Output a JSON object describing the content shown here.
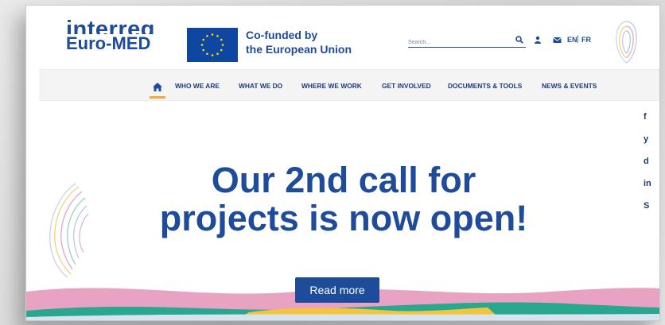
{
  "header": {
    "logo_top": "interreg",
    "logo_bottom": "Euro-MED",
    "eu_line1": "Co-funded by",
    "eu_line2": "the European Union",
    "search_placeholder": "Search...",
    "lang_en": "EN",
    "lang_sep": "|",
    "lang_fr": "FR"
  },
  "nav": {
    "items": [
      {
        "label": "WHO WE ARE"
      },
      {
        "label": "WHAT WE DO"
      },
      {
        "label": "WHERE WE WORK"
      },
      {
        "label": "GET INVOLVED"
      },
      {
        "label": "DOCUMENTS & TOOLS"
      },
      {
        "label": "NEWS & EVENTS"
      }
    ]
  },
  "social": [
    "f",
    "y",
    "d",
    "in",
    "S"
  ],
  "hero": {
    "line1": "Our 2nd call for",
    "line2": "projects is now open!",
    "cta": "Read more"
  },
  "colors": {
    "brand_blue": "#1f4b9b",
    "accent_orange": "#f4a938",
    "wave_pink": "#e8a3c2",
    "wave_teal": "#2aa88f",
    "wave_yellow": "#f3c53f"
  },
  "icons": [
    "search-icon",
    "user-icon",
    "mail-icon",
    "home-icon",
    "fingerprint-icon"
  ]
}
